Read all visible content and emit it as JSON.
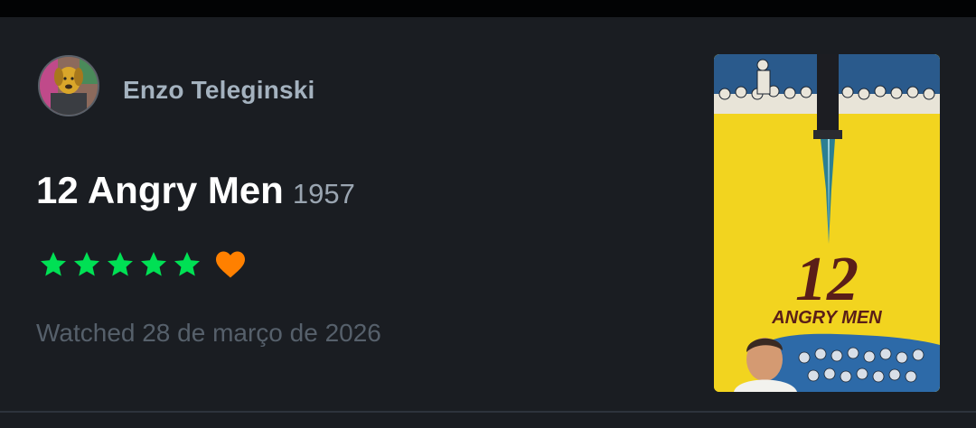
{
  "review": {
    "user_name": "Enzo Teleginski",
    "film_title": "12 Angry Men",
    "film_year": "1957",
    "rating_stars": 5,
    "liked": true,
    "watched_text": "Watched 28 de março de 2026"
  },
  "poster": {
    "big_number": "12",
    "title_text": "ANGRY MEN"
  },
  "colors": {
    "background": "#1a1d22",
    "star": "#00e054",
    "heart": "#ff8000",
    "poster_yellow": "#f2d41f"
  }
}
